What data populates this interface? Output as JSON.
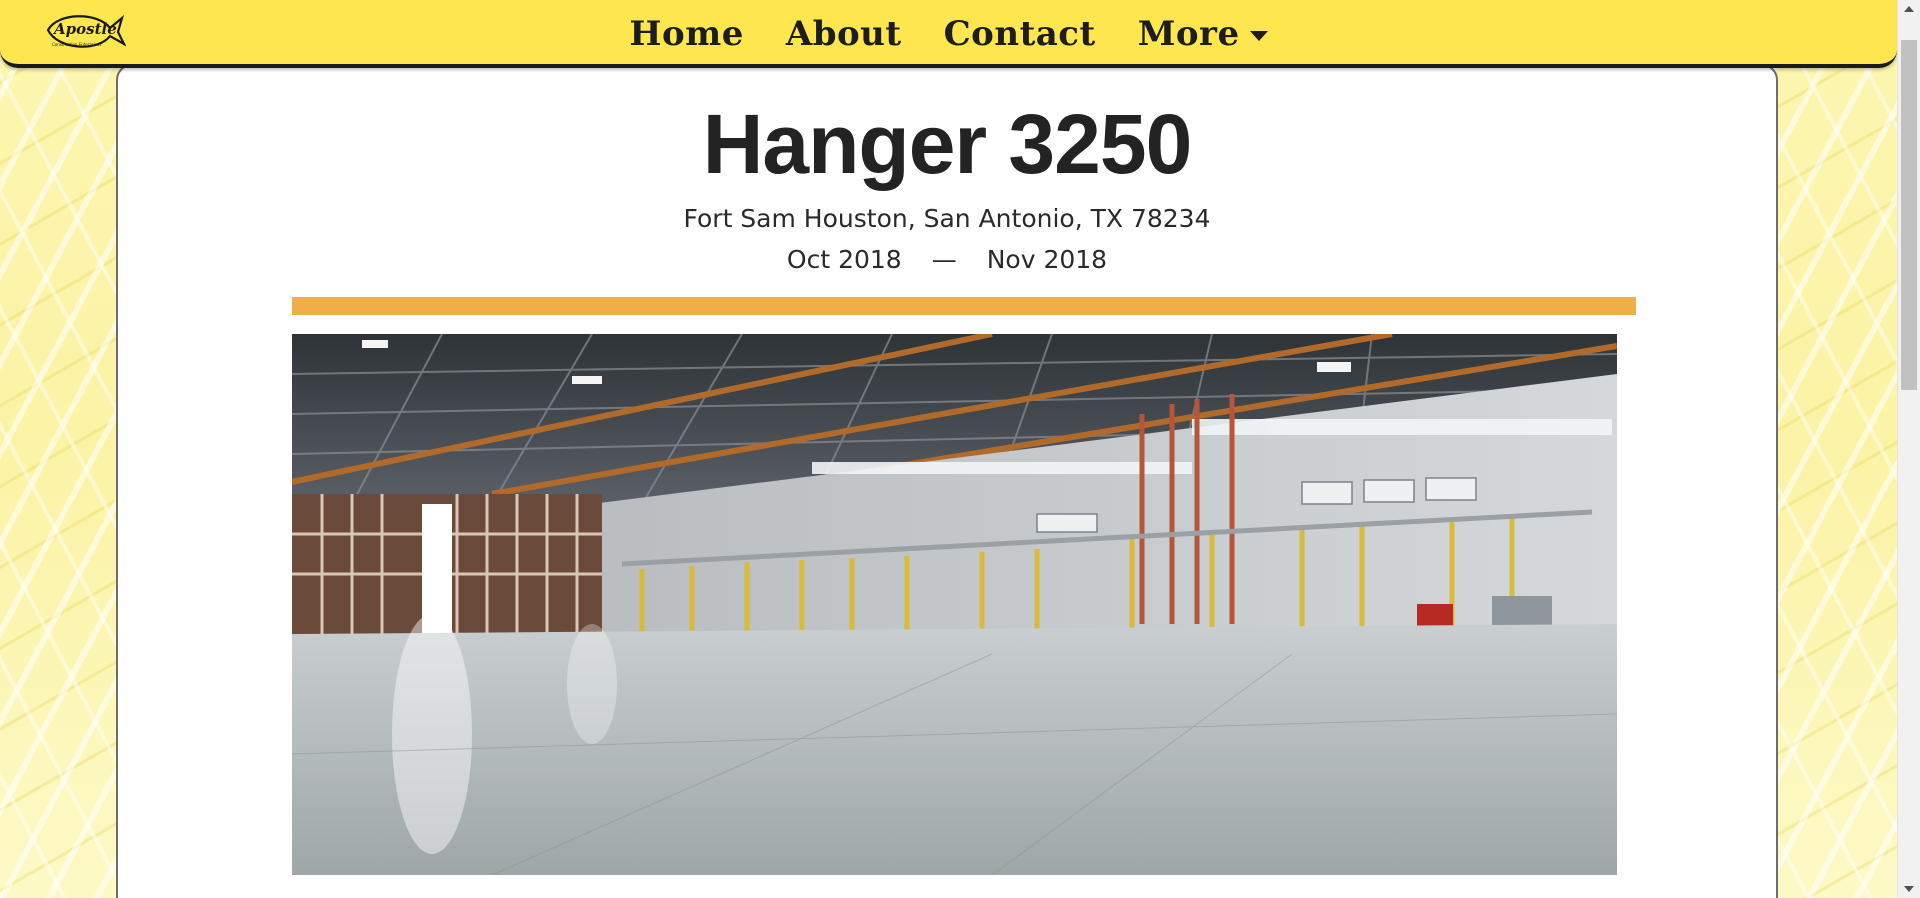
{
  "navbar": {
    "logo_text": "Apostle",
    "items": [
      {
        "label": "Home"
      },
      {
        "label": "About"
      },
      {
        "label": "Contact"
      },
      {
        "label": "More"
      }
    ]
  },
  "project": {
    "title": "Hanger 3250",
    "address": "Fort Sam Houston, San Antonio, TX 78234",
    "start_date": "Oct 2018",
    "date_separator": "—",
    "end_date": "Nov 2018"
  },
  "colors": {
    "navbar_bg": "#fde64e",
    "accent_bar": "#efae4a",
    "page_bg": "#fbf6b4",
    "text": "#232323"
  },
  "icons": {
    "logo": "fish-logo-icon",
    "dropdown": "caret-down-icon"
  }
}
